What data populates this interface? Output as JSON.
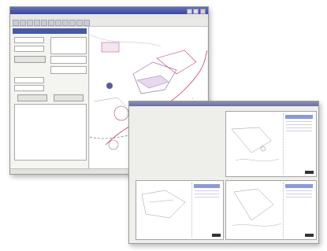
{
  "colors": {
    "titlebar": "#3a4aa0",
    "panel_header": "#445aa8",
    "map_line": "#c23c7a",
    "map_dash": "#5a8a5a",
    "window_bg": "#f2f2ef"
  },
  "icons": {
    "minimize": "minimize-icon",
    "maximize": "maximize-icon",
    "close": "close-icon"
  }
}
